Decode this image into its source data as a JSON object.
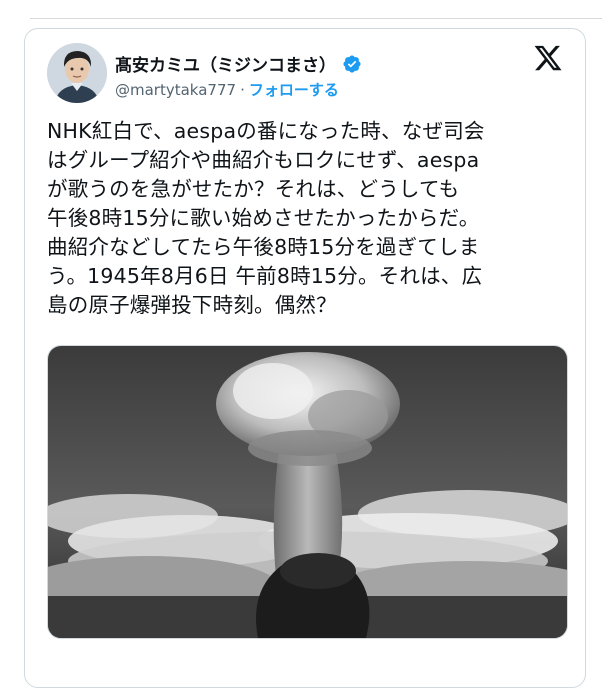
{
  "tweet": {
    "author_name": "髙安カミユ（ミジンコまさ）",
    "handle": "@martytaka777",
    "separator": "·",
    "follow_label": "フォローする",
    "verified": true,
    "text": "NHK紅白で、aespaの番になった時、なぜ司会はグループ紹介や曲紹介もロクにせず、aespaが歌うのを急がせたか？それは、どうしても午後8時15分に歌い始めさせたかったからだ。曲紹介などしてたら午後8時15分を過ぎてしまう。1945年8月6日 午前8時15分。それは、広島の原子爆弾投下時刻。偶然？",
    "text_lines": [
      "NHK紅白で、aespaの番になった時、なぜ司会",
      "はグループ紹介や曲紹介もロクにせず、aespa",
      "が歌うのを急がせたか？それは、どうしても",
      "午後8時15分に歌い始めさせたかったからだ。",
      "曲紹介などしてたら午後8時15分を過ぎてしま",
      "う。1945年8月6日 午前8時15分。それは、広",
      "島の原子爆弾投下時刻。偶然？"
    ]
  },
  "icons": {
    "verified": "verified-badge-icon",
    "brand": "x-logo-icon"
  },
  "colors": {
    "accent": "#1d9bf0",
    "text": "#0f1419",
    "muted": "#536471",
    "border": "#cfd9de"
  }
}
